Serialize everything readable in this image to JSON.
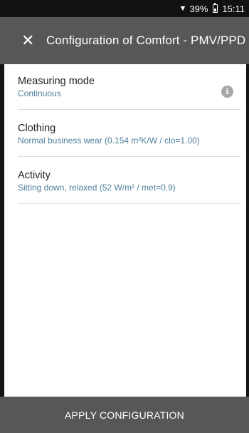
{
  "status_bar": {
    "wifi_icon": "wifi-icon",
    "battery_percent": "39%",
    "battery_icon": "battery-icon",
    "time": "15:11"
  },
  "app_bar": {
    "close_icon": "close-icon",
    "title": "Configuration of Comfort - PMV/PPD"
  },
  "settings": [
    {
      "label": "Measuring mode",
      "value": "Continuous",
      "icon": "info-icon"
    },
    {
      "label": "Clothing",
      "value": "Normal business wear (0.154 m²K/W / clo=1.00)"
    },
    {
      "label": "Activity",
      "value": "Sitting down, relaxed (52 W/m² / met=0.9)"
    }
  ],
  "bottom_bar": {
    "apply_label": "APPLY CONFIGURATION"
  },
  "colors": {
    "app_bar_bg": "#575757",
    "status_bar_bg": "#111111",
    "value_text": "#4f7f9b",
    "divider": "#dedede"
  }
}
